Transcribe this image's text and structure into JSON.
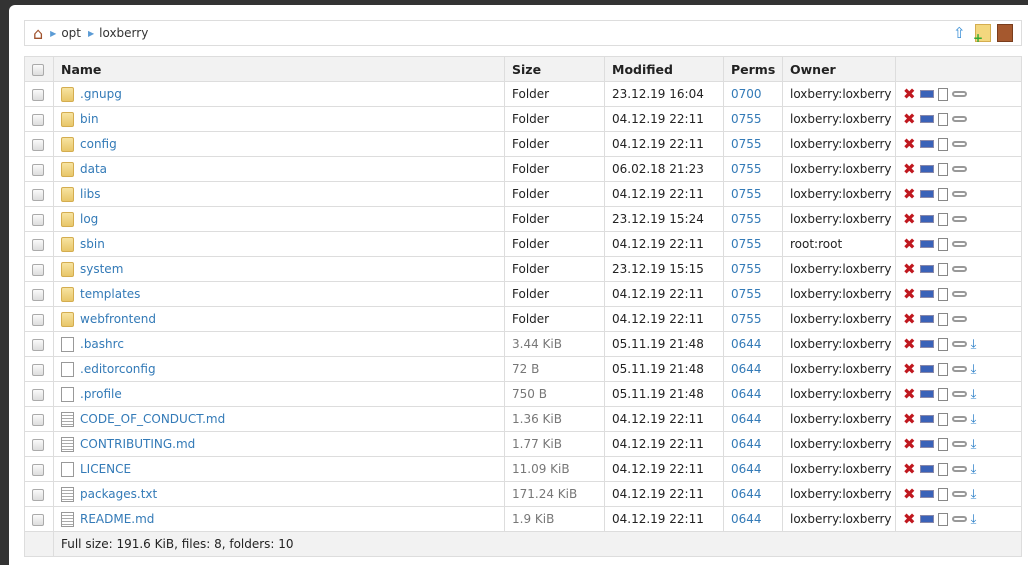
{
  "breadcrumb": {
    "items": [
      "opt",
      "loxberry"
    ]
  },
  "toolbar": {
    "icons": [
      "upload-icon",
      "new-folder-icon",
      "logout-icon"
    ]
  },
  "table": {
    "headers": {
      "name": "Name",
      "size": "Size",
      "modified": "Modified",
      "perms": "Perms",
      "owner": "Owner"
    },
    "rows": [
      {
        "name": ".gnupg",
        "type": "folder",
        "size": "Folder",
        "modified": "23.12.19 16:04",
        "perms": "0700",
        "owner": "loxberry:loxberry"
      },
      {
        "name": "bin",
        "type": "folder",
        "size": "Folder",
        "modified": "04.12.19 22:11",
        "perms": "0755",
        "owner": "loxberry:loxberry"
      },
      {
        "name": "config",
        "type": "folder",
        "size": "Folder",
        "modified": "04.12.19 22:11",
        "perms": "0755",
        "owner": "loxberry:loxberry"
      },
      {
        "name": "data",
        "type": "folder",
        "size": "Folder",
        "modified": "06.02.18 21:23",
        "perms": "0755",
        "owner": "loxberry:loxberry"
      },
      {
        "name": "libs",
        "type": "folder",
        "size": "Folder",
        "modified": "04.12.19 22:11",
        "perms": "0755",
        "owner": "loxberry:loxberry"
      },
      {
        "name": "log",
        "type": "folder",
        "size": "Folder",
        "modified": "23.12.19 15:24",
        "perms": "0755",
        "owner": "loxberry:loxberry"
      },
      {
        "name": "sbin",
        "type": "folder",
        "size": "Folder",
        "modified": "04.12.19 22:11",
        "perms": "0755",
        "owner": "root:root"
      },
      {
        "name": "system",
        "type": "folder",
        "size": "Folder",
        "modified": "23.12.19 15:15",
        "perms": "0755",
        "owner": "loxberry:loxberry"
      },
      {
        "name": "templates",
        "type": "folder",
        "size": "Folder",
        "modified": "04.12.19 22:11",
        "perms": "0755",
        "owner": "loxberry:loxberry"
      },
      {
        "name": "webfrontend",
        "type": "folder",
        "size": "Folder",
        "modified": "04.12.19 22:11",
        "perms": "0755",
        "owner": "loxberry:loxberry"
      },
      {
        "name": ".bashrc",
        "type": "file",
        "size": "3.44 KiB",
        "modified": "05.11.19 21:48",
        "perms": "0644",
        "owner": "loxberry:loxberry"
      },
      {
        "name": ".editorconfig",
        "type": "file",
        "size": "72 B",
        "modified": "05.11.19 21:48",
        "perms": "0644",
        "owner": "loxberry:loxberry"
      },
      {
        "name": ".profile",
        "type": "file",
        "size": "750 B",
        "modified": "05.11.19 21:48",
        "perms": "0644",
        "owner": "loxberry:loxberry"
      },
      {
        "name": "CODE_OF_CONDUCT.md",
        "type": "text",
        "size": "1.36 KiB",
        "modified": "04.12.19 22:11",
        "perms": "0644",
        "owner": "loxberry:loxberry"
      },
      {
        "name": "CONTRIBUTING.md",
        "type": "text",
        "size": "1.77 KiB",
        "modified": "04.12.19 22:11",
        "perms": "0644",
        "owner": "loxberry:loxberry"
      },
      {
        "name": "LICENCE",
        "type": "file",
        "size": "11.09 KiB",
        "modified": "04.12.19 22:11",
        "perms": "0644",
        "owner": "loxberry:loxberry"
      },
      {
        "name": "packages.txt",
        "type": "text",
        "size": "171.24 KiB",
        "modified": "04.12.19 22:11",
        "perms": "0644",
        "owner": "loxberry:loxberry"
      },
      {
        "name": "README.md",
        "type": "text",
        "size": "1.9 KiB",
        "modified": "04.12.19 22:11",
        "perms": "0644",
        "owner": "loxberry:loxberry"
      }
    ],
    "footer": "Full size: 191.6 KiB, files: 8, folders: 10"
  }
}
